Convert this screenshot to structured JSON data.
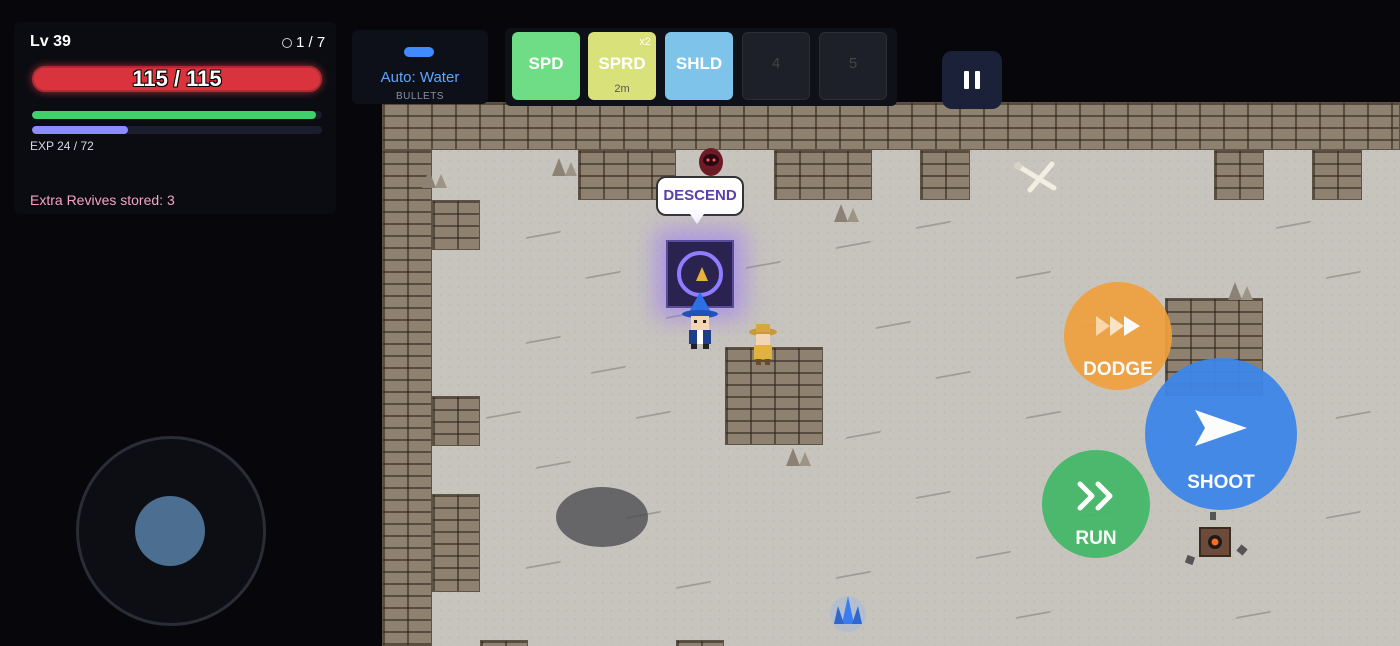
{
  "hud": {
    "level": "Lv 39",
    "floor_progress": "1 / 7",
    "hp_text": "115 / 115",
    "hp_fraction": 1.0,
    "mana_fraction": 0.98,
    "exp_fraction": 0.33,
    "exp_text": "EXP 24 / 72",
    "revives_text": "Extra Revives stored: 3"
  },
  "weapon": {
    "label": "Auto: Water",
    "sub_label": "BULLETS"
  },
  "skills": [
    {
      "label": "SPD",
      "color": "#6fdc86"
    },
    {
      "label": "SPRD",
      "multiplier": "x2",
      "timer": "2m",
      "color": "#d9e27a"
    },
    {
      "label": "SHLD",
      "color": "#7ec4ea"
    },
    {
      "label": "4"
    },
    {
      "label": "5"
    }
  ],
  "controls": {
    "dodge_label": "DODGE",
    "shoot_label": "SHOOT",
    "run_label": "RUN",
    "dodge_color": "#f0a03c",
    "shoot_color": "#3d86e8",
    "run_color": "#45b869"
  },
  "world": {
    "prompt_label": "DESCEND",
    "accent_color": "#8f7cff"
  }
}
